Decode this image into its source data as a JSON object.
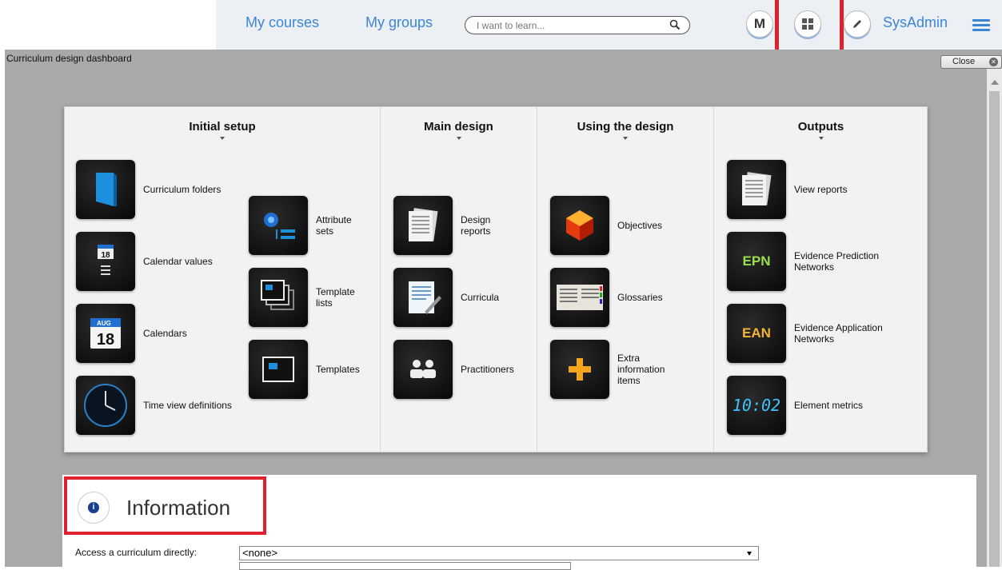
{
  "nav": {
    "my_courses": "My courses",
    "my_groups": "My groups",
    "search_placeholder": "I want to learn...",
    "m_button": "M",
    "user": "SysAdmin"
  },
  "frame": {
    "title": "Curriculum design dashboard",
    "close_label": "Close"
  },
  "columns": {
    "initial_setup": "Initial setup",
    "main_design": "Main design",
    "using_design": "Using the design",
    "outputs": "Outputs"
  },
  "tiles": {
    "curriculum_folders": "Curriculum folders",
    "calendar_values": "Calendar values",
    "calendars": "Calendars",
    "time_view_definitions": "Time view definitions",
    "attribute_sets": "Attribute sets",
    "template_lists": "Template lists",
    "templates": "Templates",
    "design_reports": "Design reports",
    "curricula": "Curricula",
    "practitioners": "Practitioners",
    "objectives": "Objectives",
    "glossaries": "Glossaries",
    "extra_information_items": "Extra information items",
    "view_reports": "View reports",
    "evidence_prediction_networks": "Evidence Prediction Networks",
    "evidence_application_networks": "Evidence Application Networks",
    "element_metrics": "Element metrics"
  },
  "icon_text": {
    "cal_month": "AUG",
    "cal_day": "18",
    "calval_day": "18",
    "epn": "EPN",
    "ean": "EAN",
    "clock": "10:02"
  },
  "info": {
    "title": "Information",
    "access_label": "Access a curriculum directly:",
    "access_value": "<none>"
  },
  "colors": {
    "accent": "#3b86d4",
    "highlight": "#e0202e"
  }
}
